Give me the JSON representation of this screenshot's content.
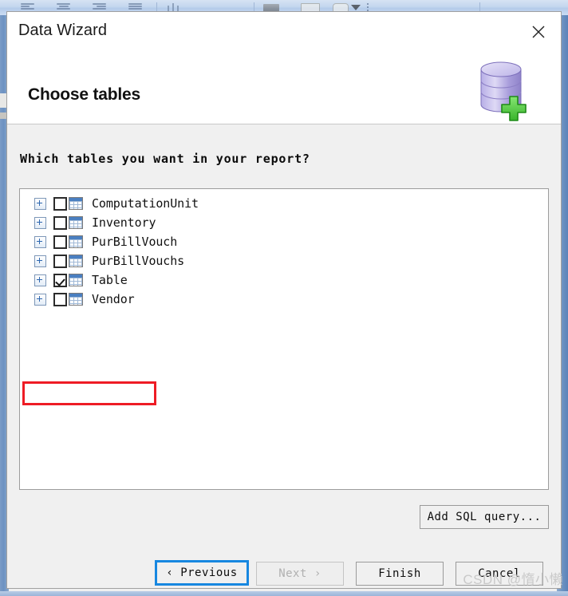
{
  "background": {
    "toolbar_label": "application-toolbar"
  },
  "dialog": {
    "title": "Data Wizard",
    "close_label": "✕",
    "heading": "Choose tables",
    "icon_name": "database-add-icon",
    "question": "Which tables you want in your report?"
  },
  "tree": {
    "items": [
      {
        "label": "ComputationUnit",
        "checked": false,
        "expandable": true,
        "highlighted": false
      },
      {
        "label": "Inventory",
        "checked": false,
        "expandable": true,
        "highlighted": false
      },
      {
        "label": "PurBillVouch",
        "checked": false,
        "expandable": true,
        "highlighted": false
      },
      {
        "label": "PurBillVouchs",
        "checked": false,
        "expandable": true,
        "highlighted": false
      },
      {
        "label": "Table",
        "checked": true,
        "expandable": true,
        "highlighted": true
      },
      {
        "label": "Vendor",
        "checked": false,
        "expandable": true,
        "highlighted": false
      }
    ]
  },
  "buttons": {
    "add_sql": "Add SQL query...",
    "previous": "‹ Previous",
    "next": "Next ›",
    "finish": "Finish",
    "cancel": "Cancel"
  },
  "colors": {
    "highlight_red": "#ee1c25",
    "focus_blue": "#1787e0",
    "table_header_blue": "#4a7fc1",
    "db_icon_purple": "#a99fdc",
    "db_icon_green": "#5ad14a"
  },
  "watermark": "CSDN @惰小懒"
}
